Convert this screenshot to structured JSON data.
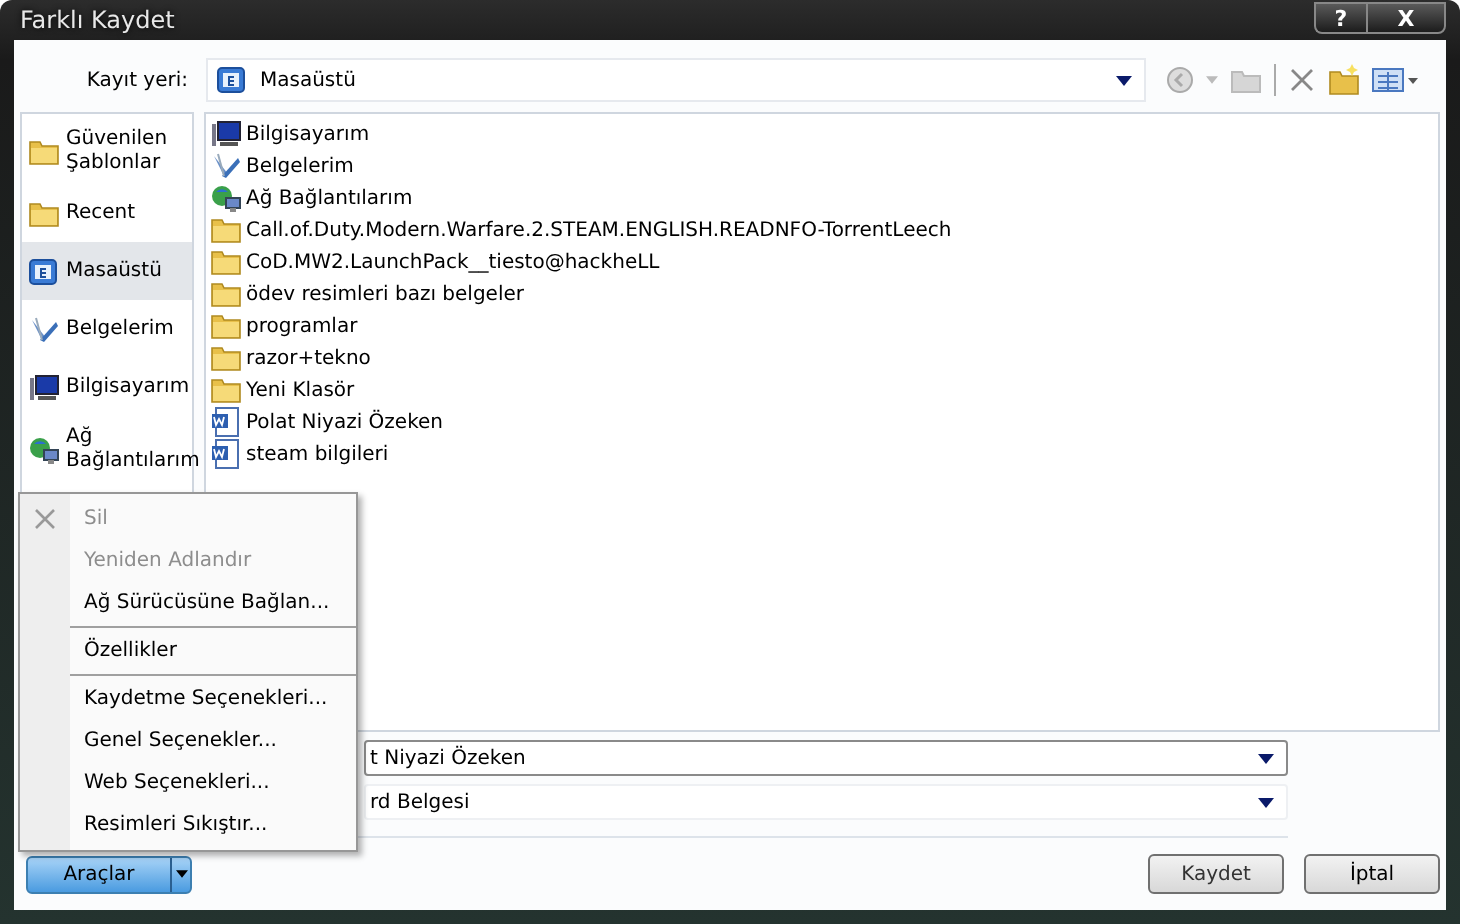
{
  "window": {
    "title": "Farklı Kaydet",
    "buttons": [
      "?",
      "X"
    ]
  },
  "location": {
    "label": "Kayıt yeri:",
    "value": "Masaüstü"
  },
  "sidebar": {
    "items": [
      {
        "label": "Güvenilen Şablonlar",
        "kind": "folder",
        "selected": false
      },
      {
        "label": "Recent",
        "kind": "folder",
        "selected": false
      },
      {
        "label": "Masaüstü",
        "kind": "desktop",
        "selected": true
      },
      {
        "label": "Belgelerim",
        "kind": "documents",
        "selected": false
      },
      {
        "label": "Bilgisayarım",
        "kind": "computer",
        "selected": false
      },
      {
        "label": "Ağ Bağlantılarım",
        "kind": "network",
        "selected": false
      }
    ]
  },
  "files": [
    {
      "name": "Bilgisayarım",
      "kind": "computer"
    },
    {
      "name": "Belgelerim",
      "kind": "documents"
    },
    {
      "name": "Ağ Bağlantılarım",
      "kind": "network"
    },
    {
      "name": "Call.of.Duty.Modern.Warfare.2.STEAM.ENGLISH.READNFO-TorrentLeech",
      "kind": "folder"
    },
    {
      "name": "CoD.MW2.LaunchPack__tiesto@hackheLL",
      "kind": "folder"
    },
    {
      "name": "ödev resimleri bazı belgeler",
      "kind": "folder"
    },
    {
      "name": "programlar",
      "kind": "folder"
    },
    {
      "name": "razor+tekno",
      "kind": "folder"
    },
    {
      "name": "Yeni Klasör",
      "kind": "folder"
    },
    {
      "name": "Polat Niyazi Özeken",
      "kind": "word"
    },
    {
      "name": "steam bilgileri",
      "kind": "word"
    }
  ],
  "file_name": {
    "value": "t Niyazi Özeken"
  },
  "file_type": {
    "value": "rd Belgesi"
  },
  "tools_menu": {
    "groups": [
      [
        {
          "label": "Sil",
          "disabled": true,
          "kind": "delete"
        },
        {
          "label": "Yeniden Adlandır",
          "disabled": true,
          "kind": "plain"
        },
        {
          "label": "Ağ Sürücüsüne Bağlan...",
          "disabled": false,
          "kind": "plain"
        }
      ],
      [
        {
          "label": "Özellikler",
          "disabled": false,
          "kind": "plain"
        }
      ],
      [
        {
          "label": "Kaydetme Seçenekleri...",
          "disabled": false,
          "kind": "plain"
        },
        {
          "label": "Genel Seçenekler...",
          "disabled": false,
          "kind": "plain"
        },
        {
          "label": "Web Seçenekleri...",
          "disabled": false,
          "kind": "plain"
        },
        {
          "label": "Resimleri Sıkıştır...",
          "disabled": false,
          "kind": "plain"
        }
      ]
    ]
  },
  "buttons": {
    "tools": "Araçlar",
    "save": "Kaydet",
    "cancel": "İptal"
  }
}
